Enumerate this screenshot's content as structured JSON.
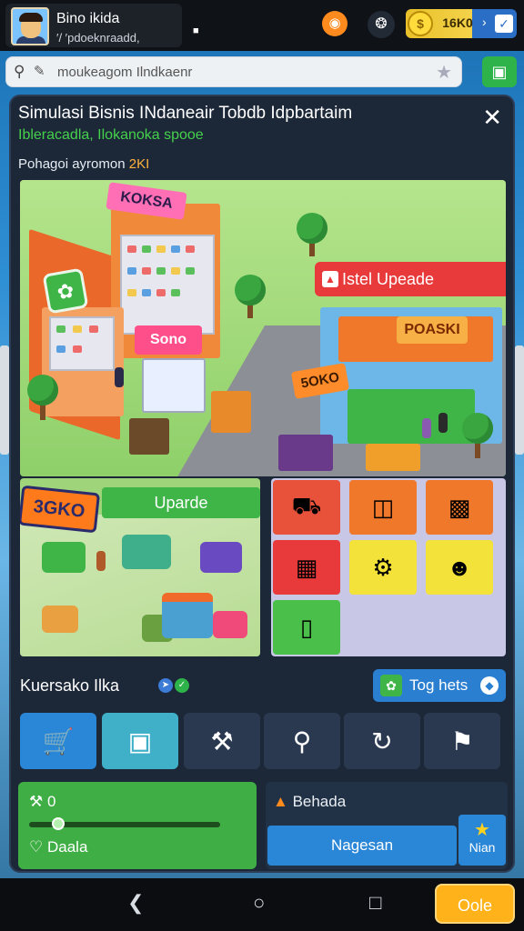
{
  "status": {
    "player_name": "Bino ikida",
    "player_sub": "′/ ′pdoeknraadd,",
    "coins": "16K0",
    "colors": {
      "coin": "#ffdc3c",
      "accent": "#2a6ec6"
    }
  },
  "search": {
    "text": "moukeagom Ilndkaenr"
  },
  "panel": {
    "title": "Simulasi Bisnis INdaneair Tobdb Idpbartaim",
    "subtitle": "Ibleracadla, Ilokanoka spooe",
    "section_label": "Pohagoi ayromon",
    "section_num": "2KI",
    "scene_upgrade_banner": "Istel Upeade",
    "scene_signs": [
      "KOKSA",
      "POASKI",
      "5OKO",
      "Sono"
    ],
    "upgrade_button": "Uparde",
    "orange_sign": "3GKO",
    "bottom_label": "Kuersako Ilka",
    "tog_button": "Tog hets",
    "card_left": {
      "row1_value": "0",
      "row3_label": "Daala",
      "slider_level": 0.15
    },
    "card_right": {
      "label": "Behada",
      "button": "Nagesan",
      "main_label": "Nian"
    }
  },
  "navbar": {
    "ok_button": "Oole"
  },
  "icons": {
    "tiles": [
      "truck-icon",
      "box-icon",
      "crate-icon",
      "shelf-icon",
      "machine-icon",
      "person-icon",
      "bin-icon"
    ],
    "tools": [
      "cart-icon",
      "crate-icon",
      "wrench-icon",
      "search-icon",
      "cycle-icon",
      "flag-icon"
    ]
  }
}
